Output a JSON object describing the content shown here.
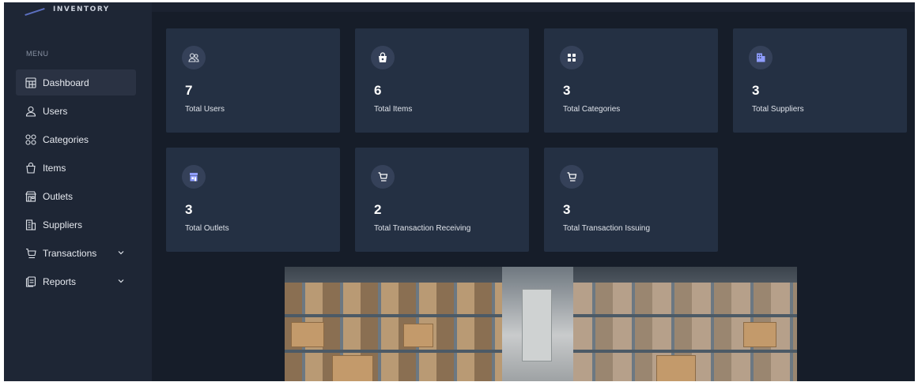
{
  "app": {
    "logo_text": "INVENTORY"
  },
  "sidebar": {
    "menu_label": "MENU",
    "items": [
      {
        "label": "Dashboard",
        "icon": "grid-icon"
      },
      {
        "label": "Users",
        "icon": "user-icon"
      },
      {
        "label": "Categories",
        "icon": "categories-icon"
      },
      {
        "label": "Items",
        "icon": "bag-icon"
      },
      {
        "label": "Outlets",
        "icon": "store-icon"
      },
      {
        "label": "Suppliers",
        "icon": "building-icon"
      },
      {
        "label": "Transactions",
        "icon": "cart-icon"
      },
      {
        "label": "Reports",
        "icon": "report-icon"
      }
    ]
  },
  "cards": [
    {
      "value": "7",
      "label": "Total Users",
      "icon": "users-icon"
    },
    {
      "value": "6",
      "label": "Total Items",
      "icon": "bag-icon"
    },
    {
      "value": "3",
      "label": "Total Categories",
      "icon": "categories-icon"
    },
    {
      "value": "3",
      "label": "Total Suppliers",
      "icon": "building-icon"
    },
    {
      "value": "3",
      "label": "Total Outlets",
      "icon": "store-icon"
    },
    {
      "value": "2",
      "label": "Total Transaction Receiving",
      "icon": "cart-icon"
    },
    {
      "value": "3",
      "label": "Total Transaction Issuing",
      "icon": "cart-icon"
    }
  ],
  "colors": {
    "sidebar_bg": "#1e2635",
    "main_bg": "#161d29",
    "card_bg": "#243043",
    "accent": "#8f9dff"
  }
}
